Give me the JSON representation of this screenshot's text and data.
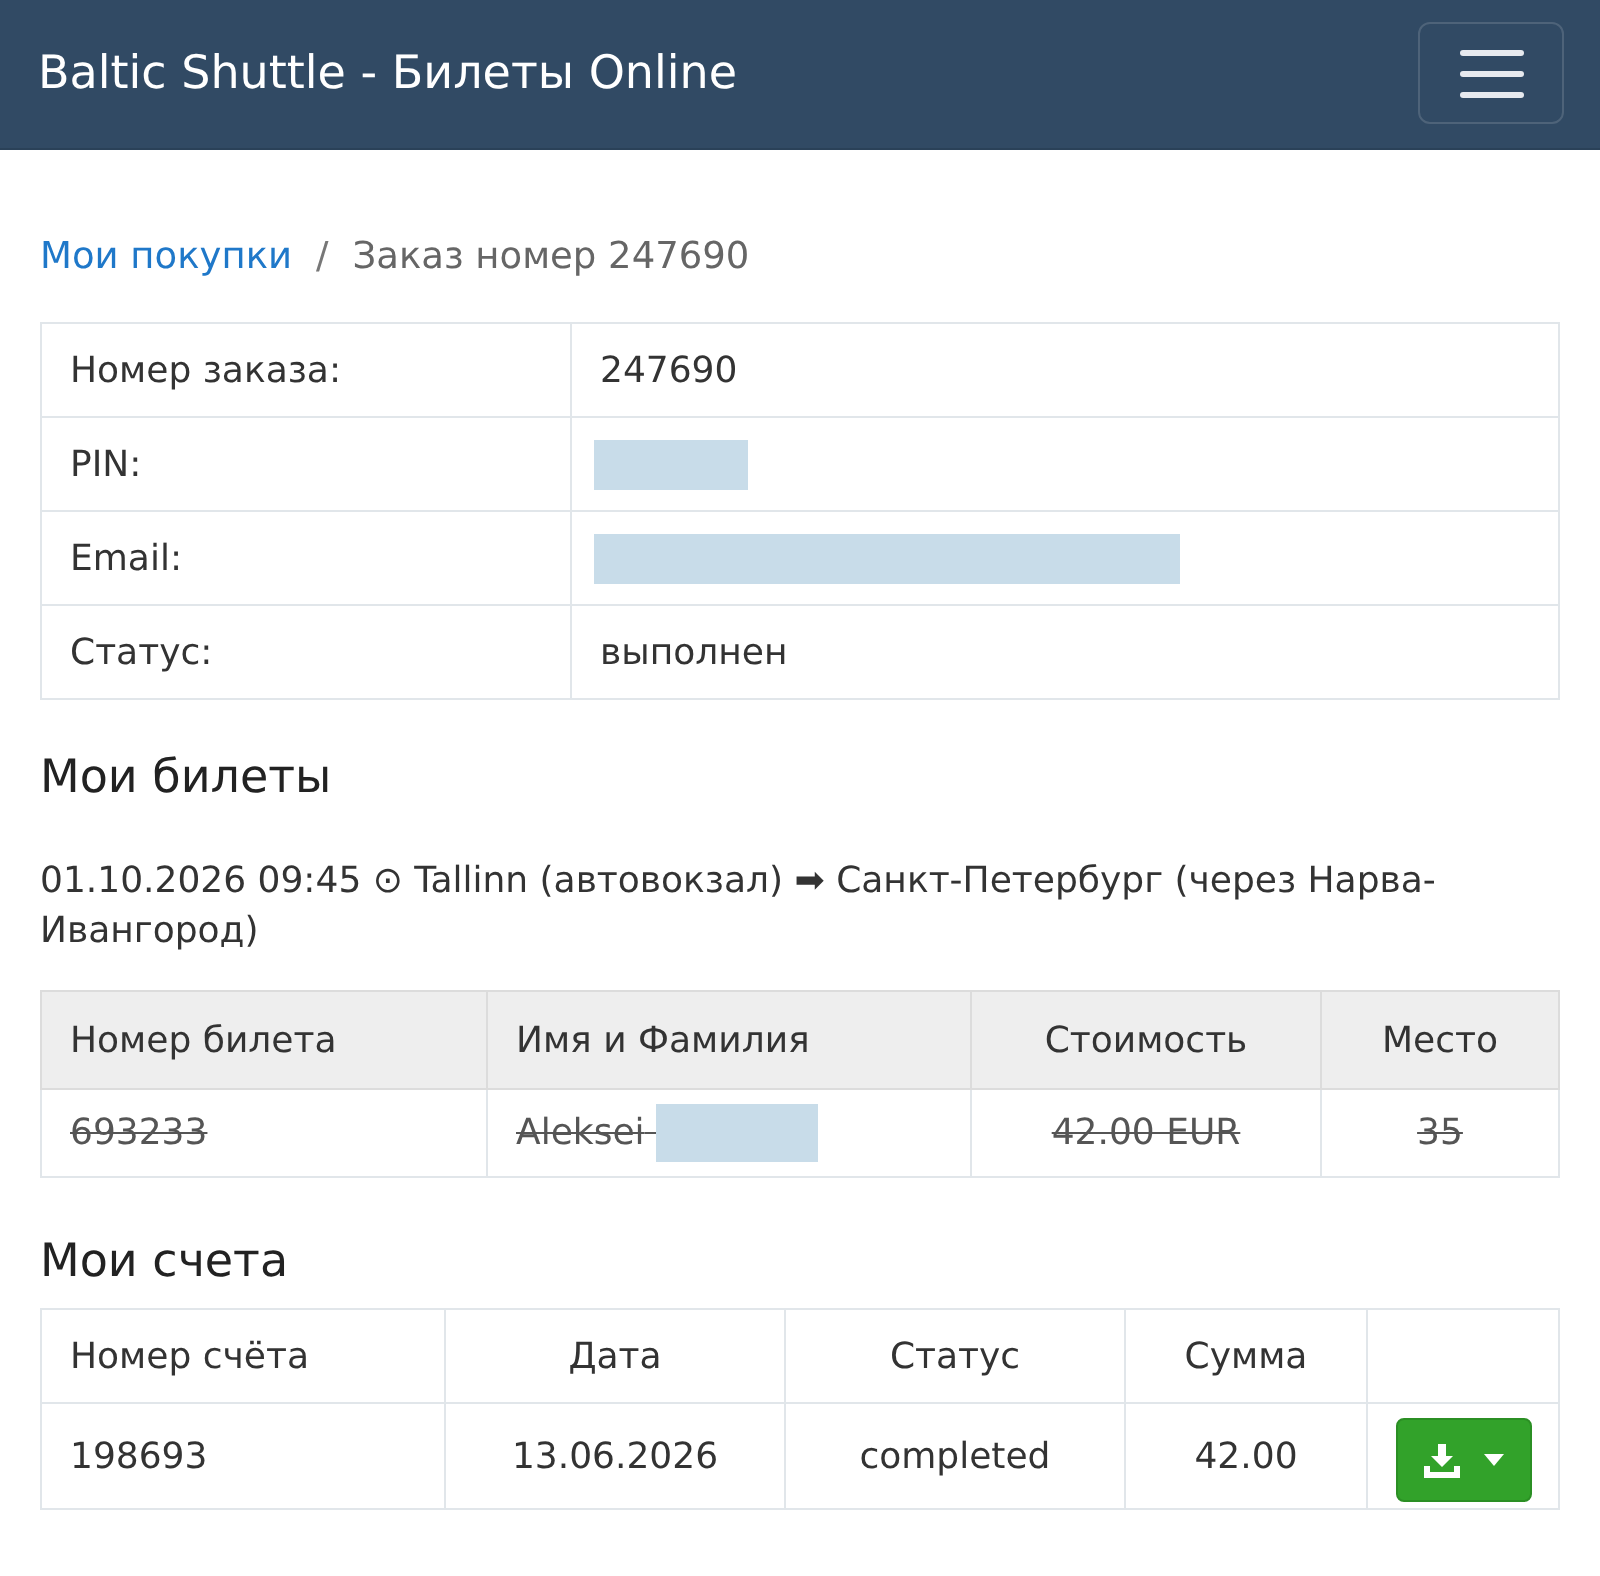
{
  "navbar": {
    "title": "Baltic Shuttle - Билеты Online"
  },
  "breadcrumb": {
    "separator": "/",
    "items": [
      {
        "label": "Мои покупки",
        "kind": "link"
      },
      {
        "label": "Заказ номер 247690",
        "kind": "current"
      }
    ]
  },
  "order_details": [
    {
      "label": "Номер заказа:",
      "value": "247690"
    },
    {
      "label": "PIN:",
      "redacted": true
    },
    {
      "label": "Email:",
      "redacted": true
    },
    {
      "label": "Статус:",
      "value": "выполнен"
    }
  ],
  "tickets_section": {
    "heading": "Мои билеты",
    "trip": "01.10.2026 09:45 ⊙ Tallinn (автовокзал) ➡ Санкт-Петербург (через Нарва-Ивангород)",
    "table": {
      "columns": [
        "Номер билета",
        "Имя и Фамилия",
        "Стоимость",
        "Место"
      ],
      "rows": [
        {
          "cancelled": true,
          "cells": [
            {
              "text": "693233"
            },
            {
              "text": "Aleksei",
              "redacted": true
            },
            {
              "text": "42.00 EUR"
            },
            {
              "text": "35"
            }
          ]
        }
      ]
    }
  },
  "invoices_section": {
    "heading": "Мои счета",
    "table": {
      "columns": [
        "Номер счёта",
        "Дата",
        "Статус",
        "Сумма"
      ],
      "rows": [
        {
          "cells": [
            "198693",
            "13.06.2026",
            "completed",
            "42.00"
          ]
        }
      ]
    }
  }
}
